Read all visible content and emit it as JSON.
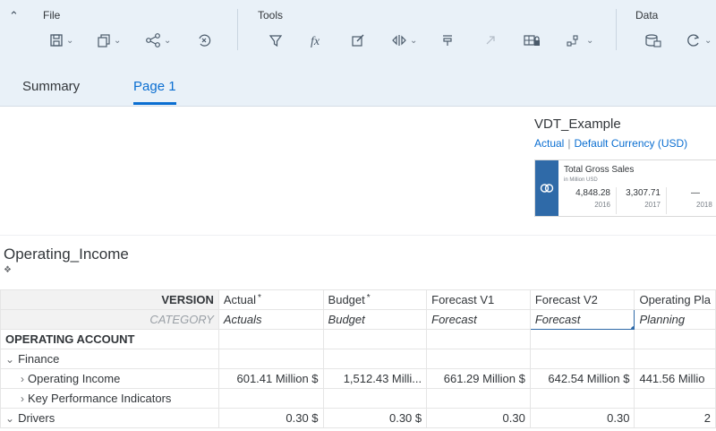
{
  "toolbar": {
    "groups": {
      "file": "File",
      "tools": "Tools",
      "data": "Data"
    }
  },
  "tabs": {
    "summary": "Summary",
    "page1": "Page 1"
  },
  "tile": {
    "title": "VDT_Example",
    "sub_version": "Actual",
    "sub_currency": "Default Currency (USD)",
    "kpi": {
      "title": "Total Gross Sales",
      "unit": "in Million USD",
      "values": [
        {
          "value": "4,848.28",
          "year": "2016"
        },
        {
          "value": "3,307.71",
          "year": "2017"
        },
        {
          "value": "—",
          "year": "2018"
        }
      ]
    }
  },
  "table": {
    "title": "Operating_Income",
    "version_label": "VERSION",
    "category_label": "CATEGORY",
    "versions": [
      "Actual",
      "Budget",
      "Forecast V1",
      "Forecast V2",
      "Operating Pla"
    ],
    "categories": [
      "Actuals",
      "Budget",
      "Forecast",
      "Forecast",
      "Planning"
    ],
    "account_header": "OPERATING ACCOUNT",
    "rows": {
      "finance": "Finance",
      "operating_income": {
        "label": "Operating Income",
        "values": [
          "601.41 Million $",
          "1,512.43 Milli...",
          "661.29 Million $",
          "642.54 Million $",
          "441.56 Millio"
        ]
      },
      "kpi": "Key Performance Indicators",
      "drivers": {
        "label": "Drivers",
        "values": [
          "0.30 $",
          "0.30 $",
          "0.30",
          "0.30",
          "2"
        ]
      }
    }
  }
}
